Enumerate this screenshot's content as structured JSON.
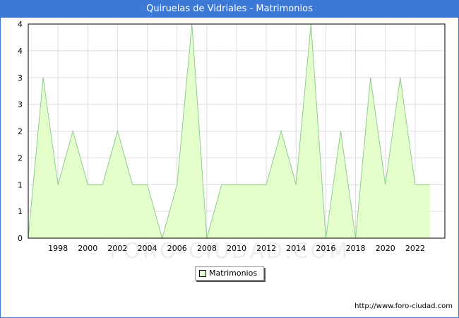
{
  "page": {
    "title": "Quiruelas de Vidriales - Matrimonios",
    "footer_url": "http://www.foro-ciudad.com",
    "watermark": "FORO-CIUDAD.COM",
    "colors": {
      "title_bar": "#3c78d8",
      "area_fill": "#e5ffcc",
      "area_line": "#8fcc8f",
      "grid": "#dddddd"
    }
  },
  "chart_data": {
    "type": "area",
    "title": "Quiruelas de Vidriales - Matrimonios",
    "xlabel": "",
    "ylabel": "",
    "x": [
      1996,
      1997,
      1998,
      1999,
      2000,
      2001,
      2002,
      2003,
      2004,
      2005,
      2006,
      2007,
      2008,
      2009,
      2010,
      2011,
      2012,
      2013,
      2014,
      2015,
      2016,
      2017,
      2018,
      2019,
      2020,
      2021,
      2022,
      2023
    ],
    "series": [
      {
        "name": "Matrimonios",
        "values": [
          0,
          3,
          1,
          2,
          1,
          1,
          2,
          1,
          1,
          0,
          1,
          4,
          0,
          1,
          1,
          1,
          1,
          2,
          1,
          4,
          0,
          2,
          0,
          3,
          1,
          3,
          1,
          1
        ]
      }
    ],
    "x_ticks": [
      1998,
      2000,
      2002,
      2004,
      2006,
      2008,
      2010,
      2012,
      2014,
      2016,
      2018,
      2020,
      2022
    ],
    "y_tick_labels": [
      "0",
      "1",
      "1",
      "2",
      "2",
      "3",
      "3",
      "4",
      "4"
    ],
    "xlim": [
      1996,
      2024
    ],
    "ylim": [
      0,
      4
    ],
    "grid": true,
    "legend": {
      "position": "bottom-center",
      "entries": [
        "Matrimonios"
      ]
    }
  }
}
